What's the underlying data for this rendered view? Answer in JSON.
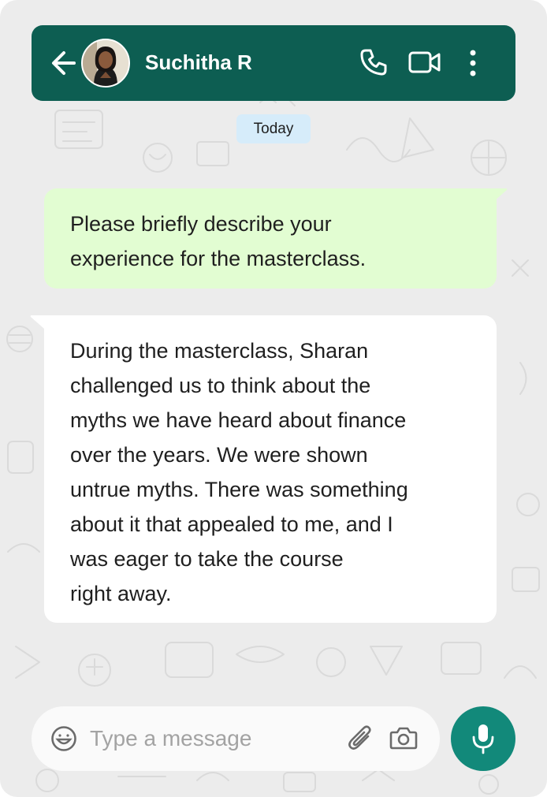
{
  "header": {
    "contact_name": "Suchitha R",
    "icons": [
      "back-arrow-icon",
      "avatar",
      "phone-icon",
      "video-camera-icon",
      "more-options-icon"
    ]
  },
  "chat": {
    "date_separator": "Today",
    "messages": [
      {
        "direction": "outgoing",
        "text": "Please briefly describe your\nexperience for the masterclass."
      },
      {
        "direction": "incoming",
        "text": "During the masterclass, Sharan\nchallenged us to think about the\nmyths we have heard about finance\nover the years. We were shown\nuntrue myths. There was something\nabout it that appealed to me, and I\nwas eager to take the course\nright away."
      }
    ]
  },
  "composer": {
    "placeholder": "Type a message",
    "icons": [
      "emoji-icon",
      "attach-icon",
      "camera-icon",
      "mic-icon"
    ]
  },
  "colors": {
    "header_bg": "#0d5e52",
    "outgoing_bubble": "#e2fdd2",
    "incoming_bubble": "#ffffff",
    "chat_bg": "#ececec",
    "date_chip": "#d6ecfa",
    "mic_button": "#12897a"
  }
}
